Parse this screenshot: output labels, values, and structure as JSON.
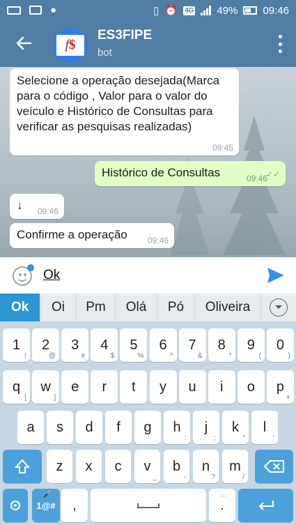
{
  "status_bar": {
    "battery": "49%",
    "time": "09:46",
    "network": "4G"
  },
  "header": {
    "title": "ES3FIPE",
    "subtitle": "bot",
    "avatar_text": "f",
    "avatar_symbol": "$"
  },
  "messages": [
    {
      "text": "Selecione a operação desejada(Marca para o código , Valor para o valor do veículo e Histórico de Consultas para verificar as pesquisas realizadas)",
      "time": "09:45",
      "from": "bot"
    },
    {
      "text": "Histórico de Consultas",
      "time": "09:46",
      "from": "user"
    },
    {
      "text": "↓",
      "time": "09:46",
      "from": "bot"
    },
    {
      "text": "Confirme a operação",
      "time": "09:46",
      "from": "bot"
    }
  ],
  "composer": {
    "value": "Ok"
  },
  "suggestions": [
    "Ok",
    "Oi",
    "Pm",
    "Olá",
    "Pó",
    "Oliveira"
  ],
  "keyboard": {
    "row1": [
      [
        "1",
        "!"
      ],
      [
        "2",
        "@"
      ],
      [
        "3",
        "#"
      ],
      [
        "4",
        "$"
      ],
      [
        "5",
        "%"
      ],
      [
        "6",
        "^"
      ],
      [
        "7",
        "&"
      ],
      [
        "8",
        "*"
      ],
      [
        "9",
        "("
      ],
      [
        "0",
        ")"
      ]
    ],
    "row2": [
      [
        "q",
        "["
      ],
      [
        "w",
        "]"
      ],
      [
        "e",
        ""
      ],
      [
        "r",
        ""
      ],
      [
        "t",
        ""
      ],
      [
        "y",
        ""
      ],
      [
        "u",
        ""
      ],
      [
        "i",
        ""
      ],
      [
        "o",
        ""
      ],
      [
        "p",
        "+"
      ]
    ],
    "row3": [
      [
        "a",
        ""
      ],
      [
        "s",
        ""
      ],
      [
        "d",
        ""
      ],
      [
        "f",
        ""
      ],
      [
        "g",
        ""
      ],
      [
        "h",
        ":"
      ],
      [
        "j",
        ";"
      ],
      [
        "k",
        "\""
      ],
      [
        "l",
        "'"
      ]
    ],
    "row4": [
      [
        "z",
        ""
      ],
      [
        "x",
        ""
      ],
      [
        "c",
        ""
      ],
      [
        "v",
        "_"
      ],
      [
        "b",
        "-"
      ],
      [
        "n",
        "?"
      ],
      [
        "m",
        "/"
      ]
    ],
    "symbols_label": "1@#",
    "comma": ",",
    "period": ".",
    "period_sub": "…"
  },
  "colors": {
    "header": "#507da3",
    "outgoing_bubble": "#e1fec6",
    "suggestion_active": "#2c96d3",
    "keyboard_bg": "#c6d7e3",
    "send": "#3a8ee6"
  }
}
